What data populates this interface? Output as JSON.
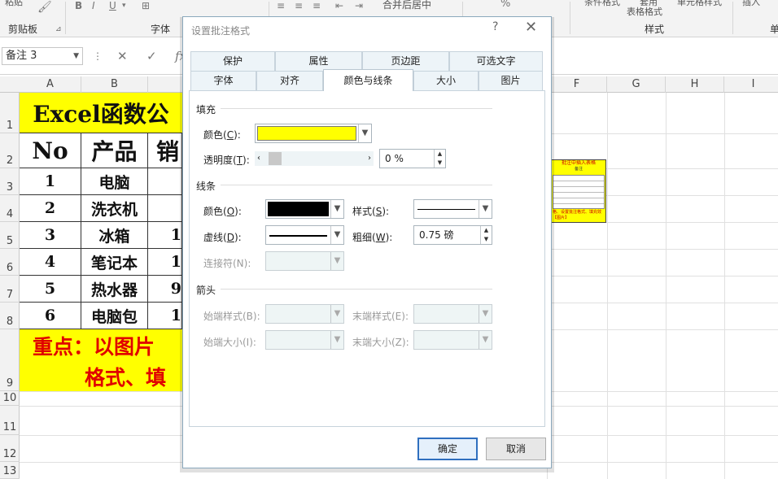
{
  "ribbon": {
    "groups": {
      "clipboard": "剪贴板",
      "font": "字体",
      "styles": "样式"
    },
    "partial": {
      "paste": "粘贴",
      "merge_center": "合并后居中",
      "cond_format": "条件格式",
      "table_format_line1": "套用",
      "table_format_line2": "表格格式",
      "cell_style": "单元格样式",
      "insert": "插入",
      "font_b": "B",
      "font_i": "I",
      "font_u": "U",
      "percent": "%",
      "next_group": "单"
    }
  },
  "formula_bar": {
    "name_box": "备注 3",
    "fx": "fx"
  },
  "sheet": {
    "columns": [
      "A",
      "B",
      "C",
      "D",
      "E",
      "F",
      "G",
      "H",
      "I"
    ],
    "rows": [
      "1",
      "2",
      "3",
      "4",
      "5",
      "6",
      "7",
      "8",
      "9",
      "10",
      "11",
      "12",
      "13"
    ],
    "title": "Excel函数公",
    "header": {
      "no": "No",
      "product": "产品",
      "sales": "销"
    },
    "data": [
      {
        "no": "1",
        "product": "电脑",
        "sales": ""
      },
      {
        "no": "2",
        "product": "洗衣机",
        "sales": ""
      },
      {
        "no": "3",
        "product": "冰箱",
        "sales": "1"
      },
      {
        "no": "4",
        "product": "笔记本",
        "sales": "1"
      },
      {
        "no": "5",
        "product": "热水器",
        "sales": "9"
      },
      {
        "no": "6",
        "product": "电脑包",
        "sales": "1"
      }
    ],
    "note_line1": "重点：以图片",
    "note_line2": "格式、填"
  },
  "comment": {
    "title": "批注中插入表格",
    "sub": "备注",
    "bottom_line1": "格、设置批注格式、填充效",
    "bottom_line2": "【图片】"
  },
  "dialog": {
    "title": "设置批注格式",
    "help": "?",
    "close": "✕",
    "tabs_row1": [
      "保护",
      "属性",
      "页边距",
      "可选文字"
    ],
    "tabs_row2": [
      "字体",
      "对齐",
      "颜色与线条",
      "大小",
      "图片"
    ],
    "fill": {
      "section": "填充",
      "color_label": "颜色(",
      "color_key": "C",
      "transparency_label": "透明度(",
      "transparency_key": "T",
      "transparency_value": "0 %"
    },
    "line": {
      "section": "线条",
      "color_label": "颜色(",
      "color_key": "O",
      "dash_label": "虚线(",
      "dash_key": "D",
      "connector_label": "连接符(N):",
      "style_label": "样式(",
      "style_key": "S",
      "weight_label": "粗细(",
      "weight_key": "W",
      "weight_value": "0.75 磅"
    },
    "arrows": {
      "section": "箭头",
      "begin_style": "始端样式(B):",
      "end_style": "末端样式(E):",
      "begin_size": "始端大小(I):",
      "end_size": "末端大小(Z):"
    },
    "ok": "确定",
    "cancel": "取消",
    "colors": {
      "fill_swatch": "#ffff00",
      "line_swatch": "#000000"
    }
  }
}
